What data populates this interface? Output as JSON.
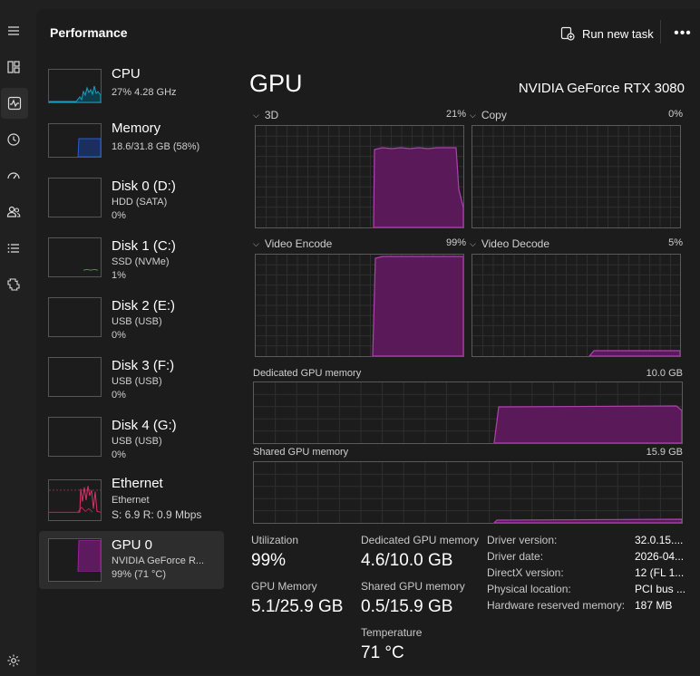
{
  "header": {
    "title": "Performance",
    "run_new_task": "Run new task",
    "more": "•••"
  },
  "nav_icons": [
    "menu-icon",
    "processes-icon",
    "performance-icon",
    "app-history-icon",
    "startup-apps-icon",
    "users-icon",
    "details-icon",
    "services-icon",
    "settings-icon"
  ],
  "devices": [
    {
      "name": "CPU",
      "line1": "27% 4.28 GHz",
      "line2": "",
      "line3": ""
    },
    {
      "name": "Memory",
      "line1": "18.6/31.8 GB (58%)",
      "line2": "",
      "line3": ""
    },
    {
      "name": "Disk 0 (D:)",
      "line1": "HDD (SATA)",
      "line2": "0%",
      "line3": ""
    },
    {
      "name": "Disk 1 (C:)",
      "line1": "SSD (NVMe)",
      "line2": "1%",
      "line3": ""
    },
    {
      "name": "Disk 2 (E:)",
      "line1": "USB (USB)",
      "line2": "0%",
      "line3": ""
    },
    {
      "name": "Disk 3 (F:)",
      "line1": "USB (USB)",
      "line2": "0%",
      "line3": ""
    },
    {
      "name": "Disk 4 (G:)",
      "line1": "USB (USB)",
      "line2": "0%",
      "line3": ""
    },
    {
      "name": "Ethernet",
      "line1": "Ethernet",
      "line2": "S: 6.9  R: 0.9 Mbps",
      "line3": ""
    },
    {
      "name": "GPU 0",
      "line1": "NVIDIA GeForce R...",
      "line2": "99% (71 °C)",
      "line3": ""
    }
  ],
  "gpu": {
    "title": "GPU",
    "model": "NVIDIA GeForce RTX 3080",
    "engines": [
      {
        "label": "3D",
        "value": "21%"
      },
      {
        "label": "Copy",
        "value": "0%"
      },
      {
        "label": "Video Encode",
        "value": "99%"
      },
      {
        "label": "Video Decode",
        "value": "5%"
      }
    ],
    "dedicated_label": "Dedicated GPU memory",
    "dedicated_max": "10.0 GB",
    "shared_label": "Shared GPU memory",
    "shared_max": "15.9 GB"
  },
  "stats": {
    "utilization_label": "Utilization",
    "utilization": "99%",
    "dedicated_label": "Dedicated GPU memory",
    "dedicated": "4.6/10.0 GB",
    "gpu_memory_label": "GPU Memory",
    "gpu_memory": "5.1/25.9 GB",
    "shared_label": "Shared GPU memory",
    "shared": "0.5/15.9 GB",
    "temperature_label": "Temperature",
    "temperature": "71 °C"
  },
  "info": [
    {
      "key": "Driver version:",
      "value": "32.0.15...."
    },
    {
      "key": "Driver date:",
      "value": "2026-04..."
    },
    {
      "key": "DirectX version:",
      "value": "12 (FL 1..."
    },
    {
      "key": "Physical location:",
      "value": "PCI bus ..."
    },
    {
      "key": "Hardware reserved memory:",
      "value": "187 MB"
    }
  ],
  "colors": {
    "gpu_accent": "#a020a0",
    "cpu_accent": "#17a2c4",
    "memory_accent": "#2a5dd0",
    "ethernet_accent": "#d6336c",
    "disk_accent": "#55a255"
  }
}
